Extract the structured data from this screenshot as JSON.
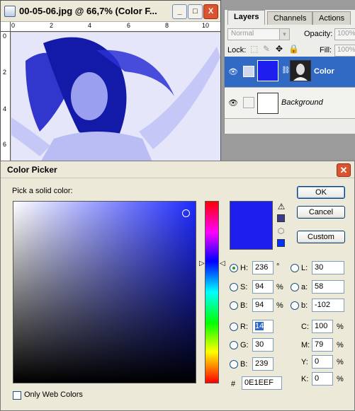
{
  "document_window": {
    "title": "00-05-06.jpg @ 66,7% (Color F...",
    "buttons": {
      "minimize": "_",
      "maximize": "□",
      "close": "X"
    },
    "ruler_top_marks": [
      "0",
      "2",
      "4",
      "6",
      "8",
      "10"
    ],
    "ruler_left_marks": [
      "0",
      "2",
      "4",
      "6"
    ]
  },
  "layers_panel": {
    "tabs": [
      "Layers",
      "Channels",
      "Actions"
    ],
    "active_tab": "Layers",
    "blend_mode": "Normal",
    "opacity_label": "Opacity:",
    "opacity_value": "100%",
    "lock_label": "Lock:",
    "fill_label": "Fill:",
    "fill_value": "100%",
    "layers": [
      {
        "name": "Color",
        "selected": true,
        "color": "#1E1EEF"
      },
      {
        "name": "Background",
        "selected": false
      }
    ]
  },
  "color_picker": {
    "title": "Color Picker",
    "pick_label": "Pick a solid color:",
    "buttons": {
      "ok": "OK",
      "cancel": "Cancel",
      "custom": "Custom"
    },
    "new_color": "#1E1EEF",
    "fields": {
      "H": {
        "label": "H:",
        "value": "236",
        "unit": "°",
        "selected": true
      },
      "S": {
        "label": "S:",
        "value": "94",
        "unit": "%"
      },
      "Bv": {
        "label": "B:",
        "value": "94",
        "unit": "%"
      },
      "R": {
        "label": "R:",
        "value": "14"
      },
      "G": {
        "label": "G:",
        "value": "30"
      },
      "Bl": {
        "label": "B:",
        "value": "239"
      },
      "L": {
        "label": "L:",
        "value": "30"
      },
      "a": {
        "label": "a:",
        "value": "58"
      },
      "b": {
        "label": "b:",
        "value": "-102"
      },
      "C": {
        "label": "C:",
        "value": "100",
        "unit": "%"
      },
      "M": {
        "label": "M:",
        "value": "79",
        "unit": "%"
      },
      "Y": {
        "label": "Y:",
        "value": "0",
        "unit": "%"
      },
      "K": {
        "label": "K:",
        "value": "0",
        "unit": "%"
      }
    },
    "hex_label": "#",
    "hex_value": "0E1EEF",
    "web_colors_label": "Only Web Colors",
    "web_colors_checked": false
  }
}
